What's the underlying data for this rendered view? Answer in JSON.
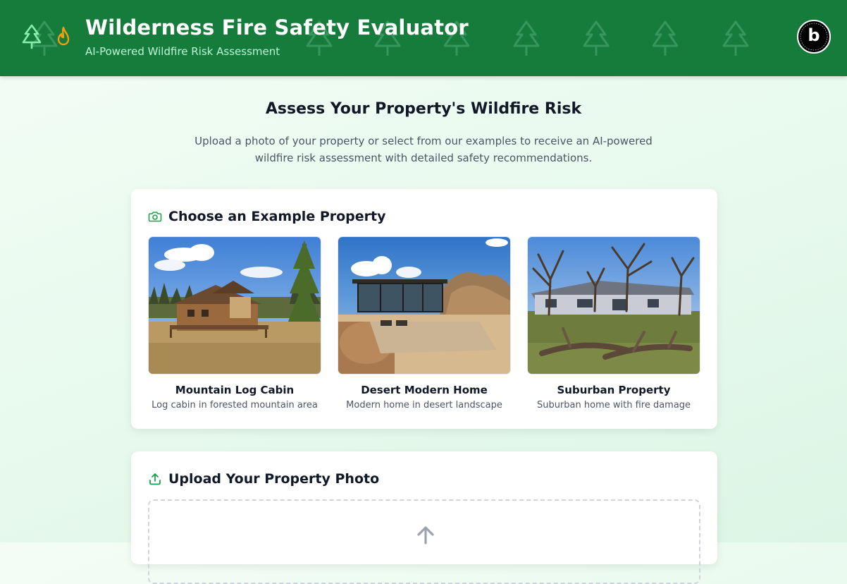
{
  "header": {
    "title": "Wilderness Fire Safety Evaluator",
    "subtitle": "AI-Powered Wildfire Risk Assessment",
    "logo_icons": [
      "tree-icon",
      "flame-icon"
    ],
    "badge_letter": "b",
    "badge_ring_text": "POWERED BY BOLT NEW"
  },
  "intro": {
    "heading": "Assess Your Property's Wildfire Risk",
    "description": "Upload a photo of your property or select from our examples to receive an AI-powered wildfire risk assessment with detailed safety recommendations."
  },
  "examples_section": {
    "title": "Choose an Example Property",
    "icon": "camera-icon",
    "items": [
      {
        "name": "Mountain Log Cabin",
        "description": "Log cabin in forested mountain area"
      },
      {
        "name": "Desert Modern Home",
        "description": "Modern home in desert landscape"
      },
      {
        "name": "Suburban Property",
        "description": "Suburban home with fire damage"
      }
    ]
  },
  "upload_section": {
    "title": "Upload Your Property Photo",
    "icon": "upload-icon"
  },
  "colors": {
    "header_bg": "#167c3c",
    "accent_green": "#16a34a",
    "subtitle_green": "#bbf7d0",
    "flame_orange": "#f59e0b"
  }
}
